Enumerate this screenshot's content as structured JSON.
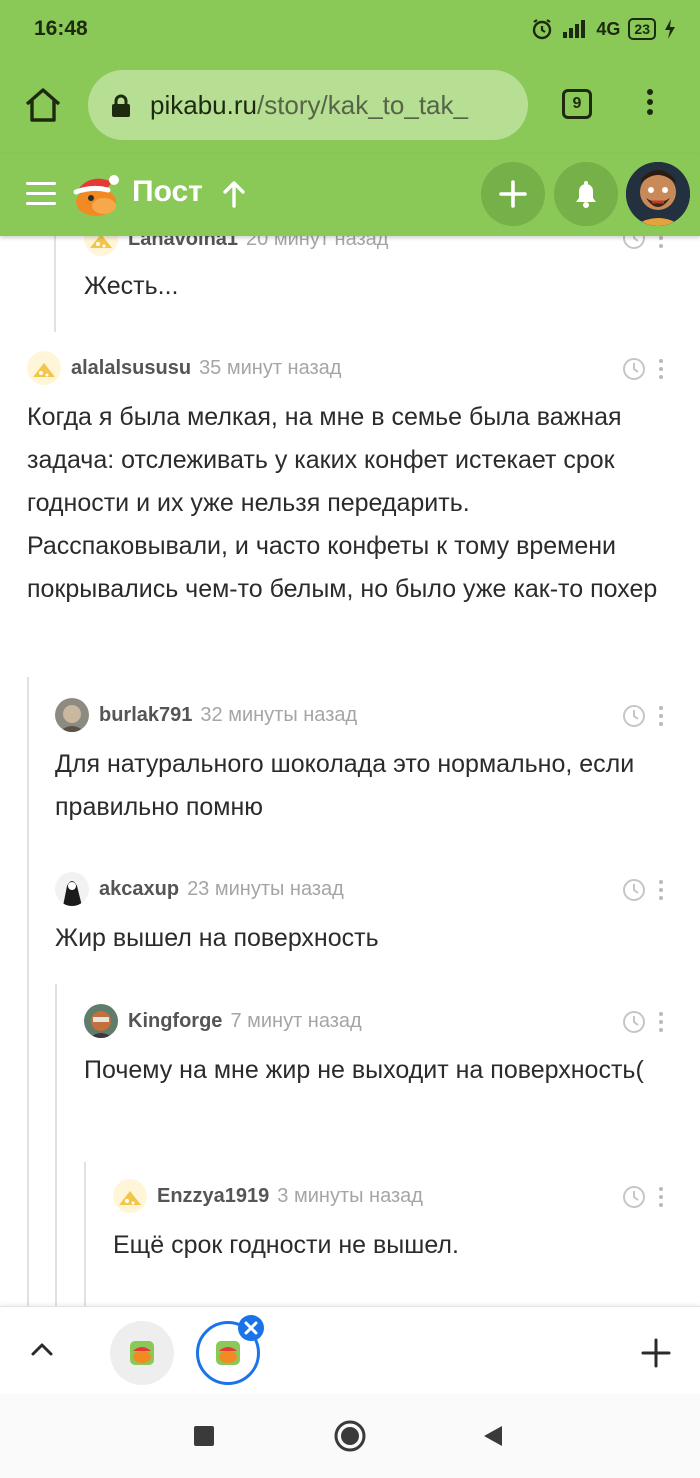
{
  "status_bar": {
    "time": "16:48",
    "network": "4G",
    "battery": "23"
  },
  "browser": {
    "url_host": "pikabu.ru",
    "url_path": "/story/kak_to_tak_",
    "tab_count": "9"
  },
  "header": {
    "title": "Пост",
    "accent_color": "#8ac858"
  },
  "comments": [
    {
      "user": "Lanavolna1",
      "time": "20 минут назад",
      "text": "Жесть..."
    },
    {
      "user": "alalalsususu",
      "time": "35 минут назад",
      "text": "Когда я была мелкая, на мне в семье была важная задача: отслеживать у каких конфет истекает срок годности и их уже нельзя передарить. Расспаковывали, и часто конфеты к тому времени покрывались чем-то белым, но было уже как-то похер"
    },
    {
      "user": "burlak791",
      "time": "32 минуты назад",
      "text": "Для натурального шоколада это нормально, если правильно помню"
    },
    {
      "user": "akcaxup",
      "time": "23 минуты назад",
      "text": "Жир вышел на поверхность"
    },
    {
      "user": "Kingforge",
      "time": "7 минут назад",
      "text": "Почему на мне жир не выходит на поверхность("
    },
    {
      "user": "Enzzya1919",
      "time": "3 минуты назад",
      "text": "Ещё срок годности не вышел."
    }
  ],
  "icons": {
    "home": "home-icon",
    "lock": "lock-icon",
    "menu": "more-vertical-icon",
    "burger": "hamburger-menu-icon",
    "plus": "plus-icon",
    "bell": "bell-icon",
    "clock": "clock-icon"
  }
}
